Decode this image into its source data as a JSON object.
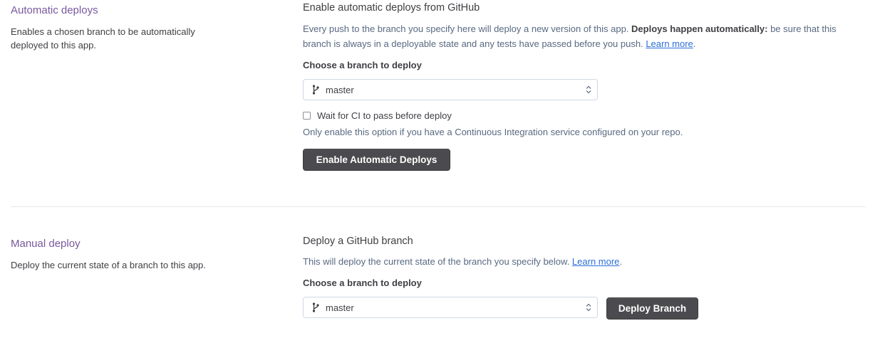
{
  "automatic": {
    "title": "Automatic deploys",
    "description": "Enables a chosen branch to be automatically deployed to this app.",
    "panel_title": "Enable automatic deploys from GitHub",
    "info_text_1": "Every push to the branch you specify here will deploy a new version of this app. ",
    "info_bold": "Deploys happen automatically:",
    "info_text_2": " be sure that this branch is always in a deployable state and any tests have passed before you push. ",
    "learn_more": "Learn more",
    "period": ".",
    "branch_label": "Choose a branch to deploy",
    "branch_value": "master",
    "ci_checkbox_label": "Wait for CI to pass before deploy",
    "ci_checkbox_checked": false,
    "ci_hint": "Only enable this option if you have a Continuous Integration service configured on your repo.",
    "button_label": "Enable Automatic Deploys"
  },
  "manual": {
    "title": "Manual deploy",
    "description": "Deploy the current state of a branch to this app.",
    "panel_title": "Deploy a GitHub branch",
    "info_text": "This will deploy the current state of the branch you specify below. ",
    "learn_more": "Learn more",
    "period": ".",
    "branch_label": "Choose a branch to deploy",
    "branch_value": "master",
    "button_label": "Deploy Branch"
  },
  "icons": {
    "branch": "git-branch-icon",
    "select_arrows": "chevron-up-down-icon"
  },
  "colors": {
    "section_title": "#79589f",
    "link": "#2d6fd8",
    "button_bg": "#4b4b4f"
  }
}
